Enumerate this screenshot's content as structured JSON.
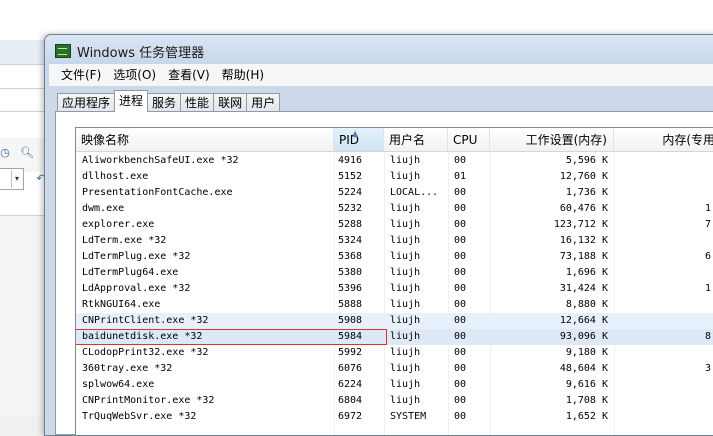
{
  "window": {
    "title": "Windows 任务管理器"
  },
  "menu": [
    "文件(F)",
    "选项(O)",
    "查看(V)",
    "帮助(H)"
  ],
  "tabs": [
    "应用程序",
    "进程",
    "服务",
    "性能",
    "联网",
    "用户"
  ],
  "active_tab": "进程",
  "columns": {
    "name": "映像名称",
    "pid": "PID",
    "user": "用户名",
    "cpu": "CPU",
    "mem": "工作设置(内存)",
    "priv": "内存(专用"
  },
  "processes": [
    {
      "name": "AliworkbenchSafeUI.exe *32",
      "pid": "4916",
      "user": "liujh",
      "cpu": "00",
      "mem": "5,596 K",
      "priv": ""
    },
    {
      "name": "dllhost.exe",
      "pid": "5152",
      "user": "liujh",
      "cpu": "01",
      "mem": "12,760 K",
      "priv": ""
    },
    {
      "name": "PresentationFontCache.exe",
      "pid": "5224",
      "user": "LOCAL...",
      "cpu": "00",
      "mem": "1,736 K",
      "priv": ""
    },
    {
      "name": "dwm.exe",
      "pid": "5232",
      "user": "liujh",
      "cpu": "00",
      "mem": "60,476 K",
      "priv": "1"
    },
    {
      "name": "explorer.exe",
      "pid": "5288",
      "user": "liujh",
      "cpu": "00",
      "mem": "123,712 K",
      "priv": "7"
    },
    {
      "name": "LdTerm.exe *32",
      "pid": "5324",
      "user": "liujh",
      "cpu": "00",
      "mem": "16,132 K",
      "priv": ""
    },
    {
      "name": "LdTermPlug.exe *32",
      "pid": "5368",
      "user": "liujh",
      "cpu": "00",
      "mem": "73,188 K",
      "priv": "6"
    },
    {
      "name": "LdTermPlug64.exe",
      "pid": "5380",
      "user": "liujh",
      "cpu": "00",
      "mem": "1,696 K",
      "priv": ""
    },
    {
      "name": "LdApproval.exe *32",
      "pid": "5396",
      "user": "liujh",
      "cpu": "00",
      "mem": "31,424 K",
      "priv": "1"
    },
    {
      "name": "RtkNGUI64.exe",
      "pid": "5888",
      "user": "liujh",
      "cpu": "00",
      "mem": "8,880 K",
      "priv": ""
    },
    {
      "name": "CNPrintClient.exe *32",
      "pid": "5908",
      "user": "liujh",
      "cpu": "00",
      "mem": "12,664 K",
      "priv": ""
    },
    {
      "name": "baidunetdisk.exe *32",
      "pid": "5984",
      "user": "liujh",
      "cpu": "00",
      "mem": "93,096 K",
      "priv": "8"
    },
    {
      "name": "CLodopPrint32.exe *32",
      "pid": "5992",
      "user": "liujh",
      "cpu": "00",
      "mem": "9,180 K",
      "priv": ""
    },
    {
      "name": "360tray.exe *32",
      "pid": "6076",
      "user": "liujh",
      "cpu": "00",
      "mem": "48,604 K",
      "priv": "3"
    },
    {
      "name": "splwow64.exe",
      "pid": "6224",
      "user": "liujh",
      "cpu": "00",
      "mem": "9,616 K",
      "priv": ""
    },
    {
      "name": "CNPrintMonitor.exe *32",
      "pid": "6804",
      "user": "liujh",
      "cpu": "00",
      "mem": "1,708 K",
      "priv": ""
    },
    {
      "name": "TrQuqWebSvr.exe *32",
      "pid": "6972",
      "user": "SYSTEM",
      "cpu": "00",
      "mem": "1,652 K",
      "priv": ""
    }
  ],
  "highlighted_row": "baidunetdisk.exe *32",
  "colors": {
    "highlight_border": "#e03030",
    "selection": "#dde9f7"
  }
}
